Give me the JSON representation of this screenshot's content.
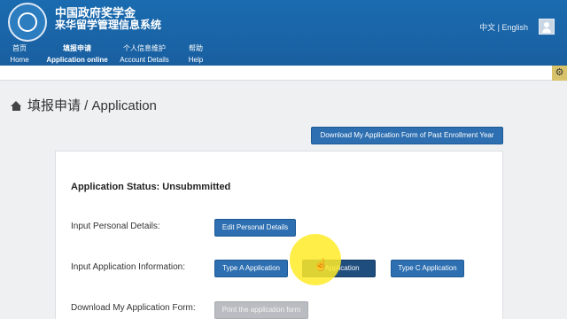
{
  "header": {
    "title_line1": "中国政府奖学金",
    "title_line2": "来华留学管理信息系统",
    "language_switch": "中文 | English",
    "avatar_icon": "user-avatar-icon"
  },
  "nav": {
    "items": [
      {
        "zh": "首页",
        "en": "Home"
      },
      {
        "zh": "填报申请",
        "en": "Application online"
      },
      {
        "zh": "个人信息维护",
        "en": "Account Details"
      },
      {
        "zh": "帮助",
        "en": "Help"
      }
    ],
    "active_index": 1
  },
  "settings_icon": "gear-icon",
  "breadcrumb": {
    "icon": "home-icon",
    "text": "填报申请 / Application"
  },
  "download_past_label": "Download My Application Form of Past Enrollment Year",
  "application": {
    "status_text": "Application Status: Unsubmmitted",
    "personal_label": "Input Personal Details:",
    "edit_personal_button": "Edit Personal Details",
    "application_info_label": "Input Application Information:",
    "type_a_button": "Type A Application",
    "type_b_button": "B Application",
    "type_c_button": "Type C Application",
    "download_form_label": "Download My Application Form:",
    "print_button": "Print the application form"
  },
  "colors": {
    "header_blue": "#1a6bb0",
    "button_blue": "#2d6fb1",
    "cursor_highlight": "#ffeb28"
  }
}
